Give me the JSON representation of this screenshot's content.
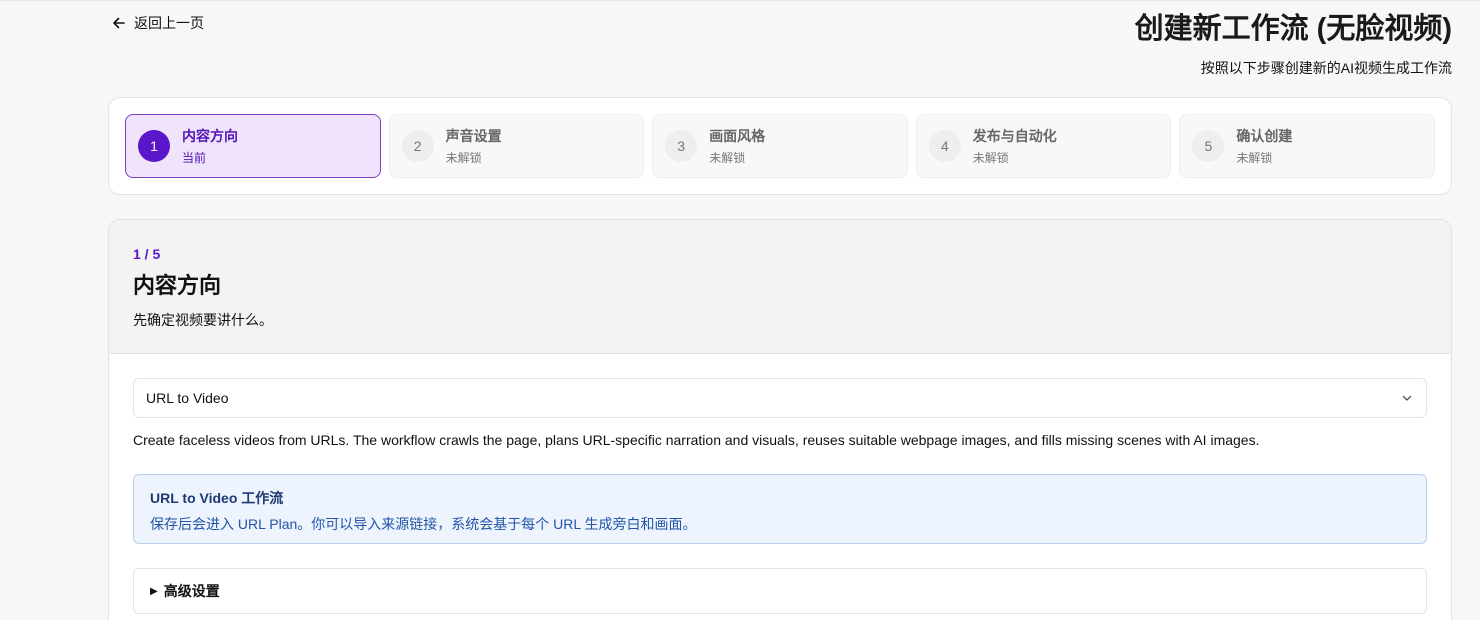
{
  "header": {
    "back_label": "返回上一页",
    "title": "创建新工作流 (无脸视频)",
    "subtitle": "按照以下步骤创建新的AI视频生成工作流"
  },
  "steps": [
    {
      "num": "1",
      "label": "内容方向",
      "status": "当前"
    },
    {
      "num": "2",
      "label": "声音设置",
      "status": "未解锁"
    },
    {
      "num": "3",
      "label": "画面风格",
      "status": "未解锁"
    },
    {
      "num": "4",
      "label": "发布与自动化",
      "status": "未解锁"
    },
    {
      "num": "5",
      "label": "确认创建",
      "status": "未解锁"
    }
  ],
  "section": {
    "counter": "1 / 5",
    "title": "内容方向",
    "description": "先确定视频要讲什么。"
  },
  "workflow_select": {
    "value": "URL to Video"
  },
  "workflow_description": "Create faceless videos from URLs. The workflow crawls the page, plans URL-specific narration and visuals, reuses suitable webpage images, and fills missing scenes with AI images.",
  "info": {
    "title": "URL to Video 工作流",
    "text": "保存后会进入 URL Plan。你可以导入来源链接，系统会基于每个 URL 生成旁白和画面。"
  },
  "advanced": {
    "label": "高级设置"
  },
  "colors": {
    "accent": "#5a16c9",
    "active_step_bg": "#efe4fb",
    "info_bg": "#edf4fd"
  }
}
